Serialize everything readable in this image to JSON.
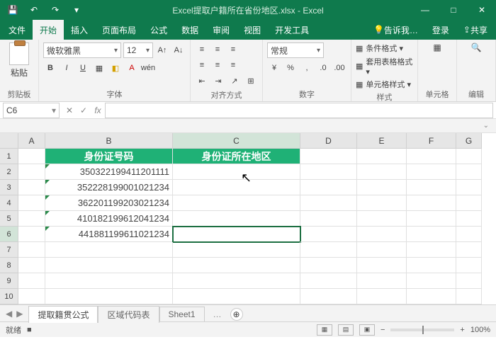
{
  "title": "Excel提取户籍所在省份地区.xlsx - Excel",
  "qat": {
    "save": "💾",
    "undo": "↶",
    "redo": "↷",
    "more": "▾"
  },
  "win": {
    "min": "—",
    "max": "□",
    "close": "✕"
  },
  "menu": {
    "file": "文件",
    "home": "开始",
    "insert": "插入",
    "layout": "页面布局",
    "formula": "公式",
    "data": "数据",
    "review": "审阅",
    "view": "视图",
    "dev": "开发工具",
    "tellme": "告诉我…",
    "login": "登录",
    "share": "共享"
  },
  "ribbon": {
    "clipboard": {
      "paste": "粘贴",
      "label": "剪贴板"
    },
    "font": {
      "name": "微软雅黑",
      "size": "12",
      "label": "字体",
      "bold": "B",
      "italic": "I",
      "under": "U"
    },
    "align": {
      "label": "对齐方式",
      "wrap": "≡"
    },
    "number": {
      "format": "常规",
      "label": "数字",
      "pct": "%",
      "comma": ",",
      "inc": "←.0",
      "dec": ".0→"
    },
    "style": {
      "cond": "条件格式 ▾",
      "table": "套用表格格式 ▾",
      "cell": "单元格样式 ▾",
      "label": "样式"
    },
    "cells": {
      "label": "单元格"
    },
    "edit": {
      "label": "编辑"
    }
  },
  "namebox": "C6",
  "fx": "fx",
  "headers": [
    "A",
    "B",
    "C",
    "D",
    "E",
    "F",
    "G"
  ],
  "table": {
    "h1": "身份证号码",
    "h2": "身份证所在地区",
    "rows": [
      "350322199411201111",
      "352228199001021234",
      "362201199203021234",
      "410182199612041234",
      "441881199611021234"
    ]
  },
  "tabs": {
    "nav_l": "◀",
    "nav_r": "▶",
    "t1": "提取籍贯公式",
    "t2": "区域代码表",
    "t3": "Sheet1",
    "dots": "…",
    "add": "⊕"
  },
  "status": {
    "ready": "就绪",
    "rec": "■",
    "views": [
      "▦",
      "▤",
      "▣"
    ],
    "zminus": "−",
    "zplus": "+",
    "zoom": "100%"
  }
}
